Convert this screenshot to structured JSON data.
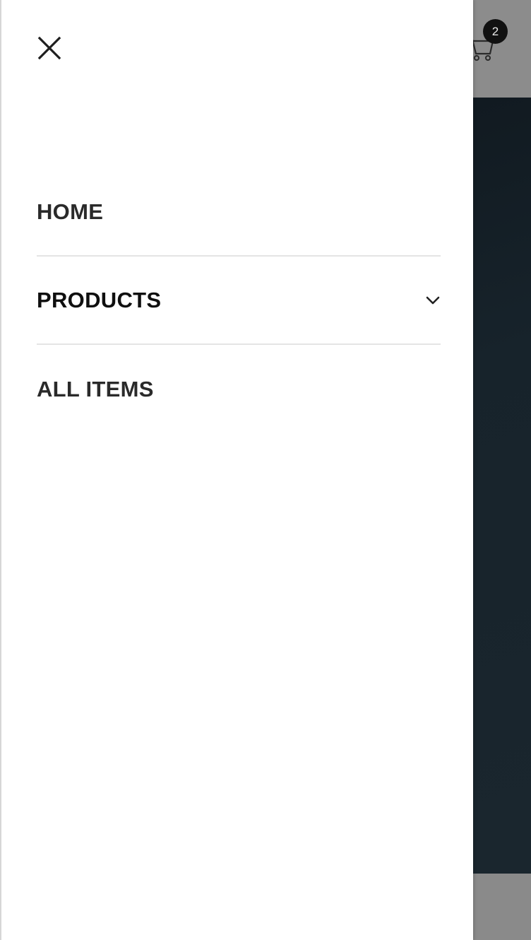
{
  "cart": {
    "icon": "cart-icon",
    "count": "2"
  },
  "drawer": {
    "close_icon": "close-icon",
    "menu": [
      {
        "label": "HOME",
        "has_submenu": false
      },
      {
        "label": "PRODUCTS",
        "has_submenu": true,
        "submenu_icon": "chevron-down-icon"
      },
      {
        "label": "ALL ITEMS",
        "has_submenu": false
      }
    ]
  },
  "colors": {
    "drawer_bg": "#ffffff",
    "overlay_dim": "#8a8a8a",
    "hero_dark": "#16212a",
    "text": "#2a2a2a",
    "divider": "#e4e4e4",
    "badge_bg": "#111111"
  }
}
